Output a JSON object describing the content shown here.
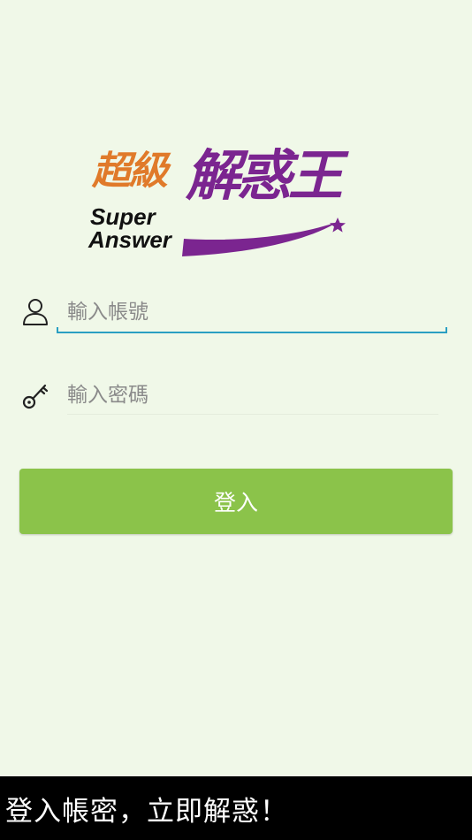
{
  "logo": {
    "chinese_small": "超級",
    "chinese_big": "解惑王",
    "english_line1": "Super",
    "english_line2": "Answer"
  },
  "form": {
    "account": {
      "placeholder": "輸入帳號",
      "value": ""
    },
    "password": {
      "placeholder": "輸入密碼",
      "value": ""
    },
    "login_label": "登入"
  },
  "toast": {
    "message": "登入帳密，立即解惑！"
  },
  "icons": {
    "account": "user-icon",
    "password": "key-icon"
  },
  "colors": {
    "background": "#f0f8e8",
    "button": "#8bc34a",
    "focus_underline": "#2a9fc2",
    "logo_orange": "#e07a2a",
    "logo_purple": "#7b2590",
    "toast_bg": "#000000"
  }
}
